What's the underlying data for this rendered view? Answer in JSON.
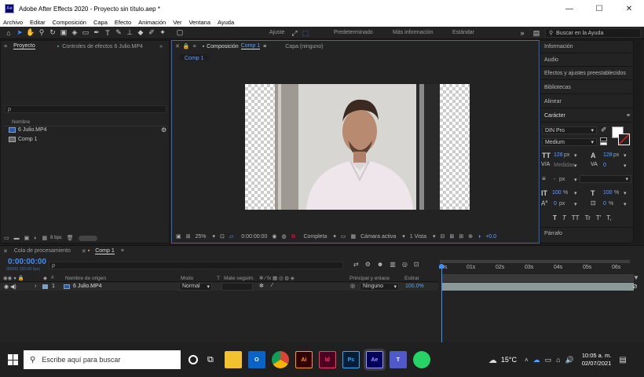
{
  "window": {
    "title": "Adobe After Effects 2020 - Proyecto sin título.aep *",
    "app_icon": "Ae",
    "minimize": "—",
    "maximize": "☐",
    "close": "✕"
  },
  "menu": [
    "Archivo",
    "Editar",
    "Composición",
    "Capa",
    "Efecto",
    "Animación",
    "Ver",
    "Ventana",
    "Ayuda"
  ],
  "toolbar": {
    "adjust_label": "Ajuste",
    "workspaces": [
      "Predeterminado",
      "Más información",
      "Estándar"
    ],
    "search_placeholder": "Buscar en la Ayuda"
  },
  "project_panel": {
    "tabs": [
      "Proyecto",
      "Controles de efectos 6 Julio.MP4"
    ],
    "search_icon": "ρ",
    "column_name": "Nombre",
    "items": [
      {
        "name": "6 Julio.MP4",
        "icon": "footage-icon"
      },
      {
        "name": "Comp 1",
        "icon": "composition-icon"
      }
    ],
    "bpc": "8 bpc"
  },
  "comp_panel": {
    "tab_prefix": "Composición",
    "tab_comp": "Comp 1",
    "tab_layer": "Capa (ninguno)",
    "subtab": "Comp 1",
    "footer": {
      "zoom": "25%",
      "timecode": "0:00:00:00",
      "resolution": "Completa",
      "camera": "Cámara activa",
      "views": "1 Vista",
      "exposure": "+0.0"
    }
  },
  "right_panel": {
    "sections": [
      "Información",
      "Audio",
      "Efectos y ajustes preestablecidos",
      "Bibliotecas",
      "Alinear"
    ],
    "character": {
      "header": "Carácter",
      "font": "DIN Pro",
      "style": "Medium",
      "size": "126",
      "size_unit": "px",
      "leading": "128",
      "leading_unit": "px",
      "kerning": "Medidas",
      "tracking": "0",
      "stroke_width": "-",
      "stroke_unit": "px",
      "vscale": "100",
      "hscale": "100",
      "pct": "%",
      "baseline": "0",
      "baseline_unit": "px",
      "tsume": "0",
      "tsume_unit": "%",
      "styles": [
        "T",
        "T",
        "TT",
        "Tr",
        "T'",
        "T,"
      ]
    },
    "paragraph": "Párrafo"
  },
  "timeline": {
    "tabs": [
      "Cola de procesamiento",
      "Comp 1"
    ],
    "timecode": "0:00:00:00",
    "fps": "00000 (30.00 fps)",
    "columns": {
      "name": "Nombre de origen",
      "mode": "Modo",
      "t": "T",
      "matte": "Mate seguim.",
      "parent": "Principal y enlace",
      "stretch": "Estirar"
    },
    "layer": {
      "index": "1",
      "name": "6 Julio.MP4",
      "mode": "Normal",
      "parent": "Ninguno",
      "stretch": "100.0%"
    },
    "ruler": [
      "0s",
      "01s",
      "02s",
      "03s",
      "04s",
      "05s",
      "06s"
    ]
  },
  "taskbar": {
    "search_placeholder": "Escribe aquí para buscar",
    "apps": [
      "file-explorer",
      "outlook",
      "chrome",
      "illustrator",
      "indesign",
      "photoshop",
      "after-effects",
      "teams",
      "whatsapp"
    ],
    "app_labels": [
      "",
      "O",
      "",
      "Ai",
      "Id",
      "Ps",
      "Ae",
      "T",
      ""
    ],
    "temperature": "15°C",
    "time": "10:05 a. m.",
    "date": "02/07/2021",
    "colors": {
      "illustrator": "#330000",
      "indesign": "#49021f",
      "photoshop": "#001e36",
      "after-effects": "#00005b"
    }
  }
}
